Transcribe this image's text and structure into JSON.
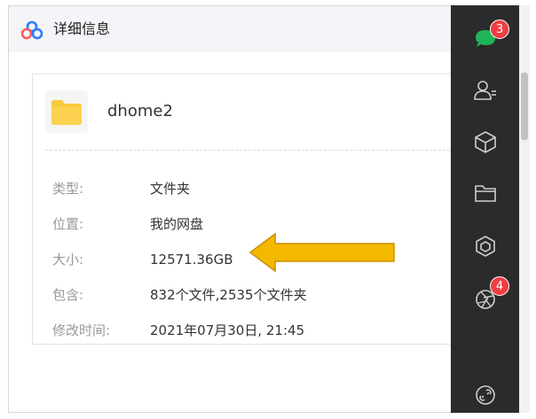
{
  "window": {
    "title": "详细信息"
  },
  "file": {
    "name": "dhome2",
    "icon": "folder-icon"
  },
  "details": [
    {
      "label": "类型:",
      "value": "文件夹"
    },
    {
      "label": "位置:",
      "value": "我的网盘"
    },
    {
      "label": "大小:",
      "value": "12571.36GB"
    },
    {
      "label": "包含:",
      "value": "832个文件,2535个文件夹"
    },
    {
      "label": "修改时间:",
      "value": "2021年07月30日, 21:45"
    }
  ],
  "annotation": {
    "arrow_color": "#f5b800",
    "points_to": "大小"
  },
  "sidebar": {
    "items": [
      {
        "icon": "chat-bubble-icon",
        "badge": "3",
        "color": "#1fb457"
      },
      {
        "icon": "contacts-icon"
      },
      {
        "icon": "cube-icon"
      },
      {
        "icon": "folder-icon"
      },
      {
        "icon": "hexagon-icon"
      },
      {
        "icon": "aperture-icon",
        "badge": "4"
      },
      {
        "icon": "link-icon"
      }
    ]
  },
  "colors": {
    "titlebar_bg": "#f3f5f8",
    "sidebar_bg": "#2b2b2b",
    "badge_bg": "#ef3f43",
    "folder": "#f7c93c"
  }
}
